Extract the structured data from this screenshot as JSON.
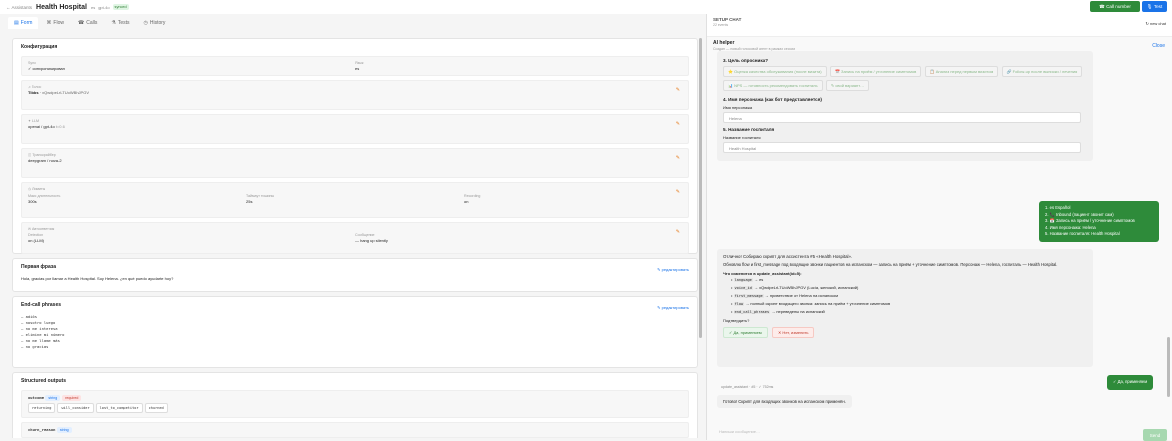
{
  "header": {
    "back": "← Assistants",
    "title": "Health Hospital",
    "chip1": "es",
    "chip2": "gpt-4o",
    "badge": "synced",
    "call_btn": "Call number",
    "test_btn": "Test"
  },
  "tabs": [
    {
      "icon": "▤",
      "label": "Form"
    },
    {
      "icon": "⌘",
      "label": "Flow"
    },
    {
      "icon": "☎",
      "label": "Calls"
    },
    {
      "icon": "⚗",
      "label": "Tests"
    },
    {
      "icon": "◷",
      "label": "History"
    }
  ],
  "config": {
    "title": "Конфигурация",
    "sys_lbl": "Sync",
    "sys_val": "✓ синхронизирован",
    "lang_lbl": "Язык",
    "lang_val": "es",
    "voice_lbl": "Голос",
    "voice_name": "Tibbs",
    "voice_id": "xQwdpeLrLTUoWBhJPGV",
    "llm_lbl": "LLM",
    "llm_val": "openai / gpt-4o",
    "llm_extra": "t=0.6",
    "tr_lbl": "Транскрайбер",
    "tr_val": "deepgram / nova-2",
    "lim_lbl": "Лимиты",
    "lim1_lbl": "Макс длительность",
    "lim1_val": "300s",
    "lim2_lbl": "Таймаут тишины",
    "lim2_val": "25s",
    "lim3_lbl": "Recording",
    "lim3_val": "on",
    "auto_lbl": "Автоответчик",
    "auto1_lbl": "Detection",
    "auto1_val": "on (LLM)",
    "auto2_lbl": "Сообщение",
    "auto2_val": "— hang up silently"
  },
  "first": {
    "title": "Первая фраза",
    "edit": "редактировать",
    "text": "Hola, gracias por llamar a Health Hospital. Soy Helena. ¿en qué puedo ayudarte hoy?"
  },
  "endcall": {
    "title": "End-call phrases",
    "edit": "редактировать",
    "items": [
      "— adiós",
      "— nosotro luego",
      "— no me interesa",
      "— elimine mi número",
      "— no me llame más",
      "— no gracias"
    ]
  },
  "structured": {
    "title": "Structured outputs",
    "field1": "outcome",
    "type1": "string",
    "req1": "required",
    "values1": [
      "returning",
      "will_consider",
      "lost_to_competitor",
      "churned"
    ],
    "field2": "churn_reason",
    "type2": "string"
  },
  "chat": {
    "setup": "SETUP CHAT",
    "setup_sub": "22 events",
    "new": "↻ new chat",
    "helper": "AI helper",
    "helper_sub": "Создан — новый голосовой агент в рамках сессии",
    "close": "Close",
    "q3": "3. Цель опросника?",
    "opts": [
      "⭐ Оценка качества обслуживания (после визита)",
      "📅 Запись на приём / уточнение симптомов",
      "📋 Анализ перед первым визитом",
      "🔗 Follow-up после выписки / лечения",
      "📊 NPS — готовность рекомендовать госпиталь",
      "✎ свой вариант…"
    ],
    "q4": "4. Имя персонажа (как бот представляется)",
    "f4_lbl": "Имя персонажа",
    "f4": "Helena",
    "q5": "5. Название госпиталя",
    "f5_lbl": "Название госпиталя",
    "f5": "Health Hospital",
    "user1": [
      "1. es Español",
      "2. 📞 Inbound (пациент звонит сам)",
      "3. 📅 Запись на приём / уточнение симптомов",
      "4. Имя персонажа: Helena",
      "5. Название госпиталя: Health Hospital"
    ],
    "ai_head": "Отлично! Собираю скрипт для ассистента #5 «Health Hospital».",
    "ai_p": "Обновлю flow и first_message под входящие звонки пациентов на испанском — запись на приём + уточнение симптомов. Персонаж — Helena, госпиталь — Health Hospital.",
    "ai_what": "Что изменится в update_assistant(id=5):",
    "changes": [
      [
        "language",
        "→ es"
      ],
      [
        "voice_id",
        "→ xQwdpeLrLTUoWBhJPGV (Lucía, женский, испанский)"
      ],
      [
        "first_message",
        "→ приветствие от Helena на испанском"
      ],
      [
        "flow",
        "→ полный скрипт входящего звонка: запись на приём + уточнение симптомов"
      ],
      [
        "end_call_phrases",
        "→ переведены на испанский"
      ]
    ],
    "confirm_q": "Подтвердить?",
    "yes": "✓ Да, применяем",
    "no": "✕ Нет, изменить",
    "user2": "✓ Да, применяем",
    "tool": "update_assistant · #5 · ✓ 752ms",
    "done": "Готово! Скрипт для входящих звонков на испанском применён.",
    "input_ph": "Напиши сообщение…",
    "send": "Send"
  }
}
